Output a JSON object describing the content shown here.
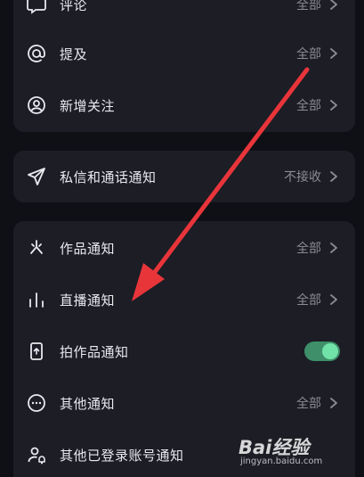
{
  "group1": {
    "items": [
      {
        "label": "评论",
        "value": "全部"
      },
      {
        "label": "提及",
        "value": "全部"
      },
      {
        "label": "新增关注",
        "value": "全部"
      }
    ]
  },
  "group2": {
    "items": [
      {
        "label": "私信和通话通知",
        "value": "不接收"
      }
    ]
  },
  "group3": {
    "items": [
      {
        "label": "作品通知",
        "value": "全部"
      },
      {
        "label": "直播通知",
        "value": "全部"
      },
      {
        "label": "拍作品通知",
        "toggle_on": true
      },
      {
        "label": "其他通知",
        "value": "全部"
      },
      {
        "label": "其他已登录账号通知"
      }
    ]
  },
  "annotation": {
    "color": "#e8353a"
  },
  "watermark": {
    "logo": "Bai经验",
    "sub": "jingyan.baidu.com"
  },
  "colors": {
    "accent_toggle_track": "#3e8f6a",
    "accent_toggle_knob": "#72e3a8",
    "card_bg": "#1c1d25",
    "page_bg": "#0f1015"
  }
}
